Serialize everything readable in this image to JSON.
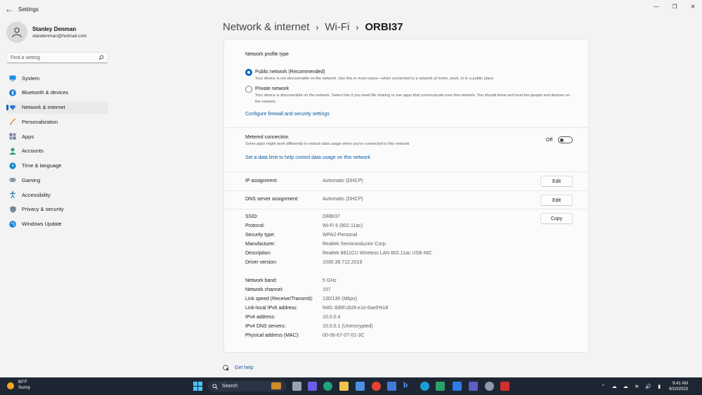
{
  "window": {
    "title": "Settings",
    "controls": [
      "minimize-icon",
      "maximize-icon",
      "close-icon"
    ]
  },
  "profile": {
    "name": "Stanley Denman",
    "email": "standenman@hotmail.com"
  },
  "search": {
    "placeholder": "Find a setting"
  },
  "sidebar": {
    "items": [
      {
        "label": "System",
        "icon": "system-icon",
        "color": "#0078d4"
      },
      {
        "label": "Bluetooth & devices",
        "icon": "bluetooth-icon",
        "color": "#0078d4"
      },
      {
        "label": "Network & internet",
        "icon": "wifi-icon",
        "color": "#2564c5",
        "active": true
      },
      {
        "label": "Personalization",
        "icon": "brush-icon",
        "color": "#e8913b"
      },
      {
        "label": "Apps",
        "icon": "apps-icon",
        "color": "#6b7a90"
      },
      {
        "label": "Accounts",
        "icon": "person-icon",
        "color": "#1fa36b"
      },
      {
        "label": "Time & language",
        "icon": "globe-clock-icon",
        "color": "#1a86c9"
      },
      {
        "label": "Gaming",
        "icon": "gamepad-icon",
        "color": "#7a8797"
      },
      {
        "label": "Accessibility",
        "icon": "accessibility-icon",
        "color": "#1c78c0"
      },
      {
        "label": "Privacy & security",
        "icon": "shield-icon",
        "color": "#7a8797"
      },
      {
        "label": "Windows Update",
        "icon": "update-icon",
        "color": "#0f7ad6"
      }
    ]
  },
  "header": {
    "crumb1": "Network & internet",
    "crumb2": "Wi-Fi",
    "current": "ORBI37"
  },
  "profile_type": {
    "heading": "Network profile type",
    "public_label": "Public network (Recommended)",
    "public_desc": "Your device is not discoverable on the network. Use this in most cases—when connected to a network at home, work, or in a public place.",
    "private_label": "Private network",
    "private_desc": "Your device is discoverable on the network. Select this if you need file sharing or use apps that communicate over this network. You should know and trust the people and devices on the network.",
    "selected": "public",
    "firewall_link": "Configure firewall and security settings"
  },
  "metered": {
    "label": "Metered connection",
    "desc": "Some apps might work differently to reduce data usage when you're connected to this network",
    "state_label": "Off",
    "enabled": false,
    "data_limit_link": "Set a data limit to help control data usage on this network"
  },
  "ip": {
    "label": "IP assignment:",
    "value": "Automatic (DHCP)",
    "button": "Edit"
  },
  "dns": {
    "label": "DNS server assignment:",
    "value": "Automatic (DHCP)",
    "button": "Edit"
  },
  "copy_button": "Copy",
  "properties": [
    {
      "label": "SSID:",
      "value": "ORBI37"
    },
    {
      "label": "Protocol:",
      "value": "Wi-Fi 5 (802.11ac)"
    },
    {
      "label": "Security type:",
      "value": "WPA2-Personal"
    },
    {
      "label": "Manufacturer:",
      "value": "Realtek Semiconductor Corp."
    },
    {
      "label": "Description:",
      "value": "Realtek 8811CU Wireless LAN 802.11ac USB NIC"
    },
    {
      "label": "Driver version:",
      "value": "1030.38.712.2019"
    }
  ],
  "properties2": [
    {
      "label": "Network band:",
      "value": "5 GHz"
    },
    {
      "label": "Network channel:",
      "value": "157"
    },
    {
      "label": "Link speed (Receive/Transmit):",
      "value": "130/130 (Mbps)"
    },
    {
      "label": "Link-local IPv6 address:",
      "value": "fe80::8d9f:cb26:e1e:6ae0%18"
    },
    {
      "label": "IPv4 address:",
      "value": "10.0.0.4"
    },
    {
      "label": "IPv4 DNS servers:",
      "value": "10.0.0.1 (Unencrypted)"
    },
    {
      "label": "Physical address (MAC):",
      "value": "00-06-67-07-01-3C"
    }
  ],
  "help": {
    "label": "Get help"
  },
  "taskbar": {
    "weather_temp": "80°F",
    "weather_cond": "Sunny",
    "search_label": "Search",
    "time": "9:41 AM",
    "date": "6/10/2023"
  }
}
